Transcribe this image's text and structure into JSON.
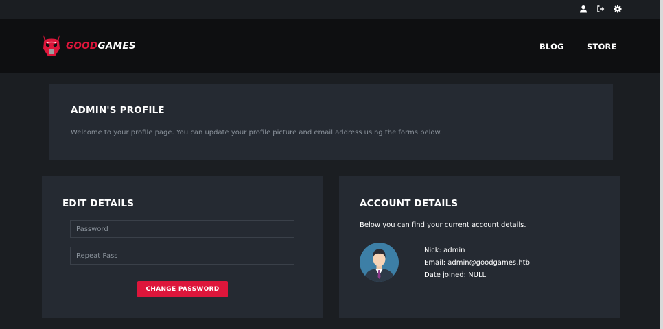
{
  "topbar": {
    "icons": [
      "user-icon",
      "logout-icon",
      "gear-icon"
    ]
  },
  "brand": {
    "logo_text_accent": "GOOD",
    "logo_text_rest": "GAMES",
    "accent_color": "#dd163b"
  },
  "nav": {
    "items": [
      {
        "label": "BLOG"
      },
      {
        "label": "STORE"
      }
    ]
  },
  "profile": {
    "title": "ADMIN'S PROFILE",
    "description": "Welcome to your profile page. You can update your profile picture and email address using the forms below."
  },
  "edit": {
    "title": "EDIT DETAILS",
    "password_placeholder": "Password",
    "repeat_placeholder": "Repeat Pass",
    "button_label": "CHANGE PASSWORD"
  },
  "account": {
    "title": "ACCOUNT DETAILS",
    "intro": "Below you can find your current account details.",
    "nick": "Nick: admin",
    "email": "Email: admin@goodgames.htb",
    "date_joined": "Date joined: NULL"
  }
}
